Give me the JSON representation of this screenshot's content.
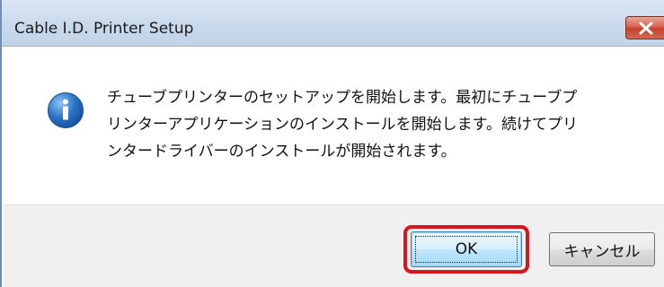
{
  "window": {
    "title": "Cable I.D. Printer Setup",
    "close_icon": "close-icon"
  },
  "dialog": {
    "icon": "info-icon",
    "message_lines": [
      "チューブプリンターのセットアップを開始します。最初にチューブプ",
      "リンターアプリケーションのインストールを開始します。続けてプリ",
      "ンタードライバーのインストールが開始されます。"
    ]
  },
  "buttons": {
    "ok_label": "OK",
    "cancel_label": "キャンセル"
  },
  "colors": {
    "highlight": "#d9141c",
    "titlebar": "#c9d9ec",
    "close_button": "#c4412d",
    "info_icon": "#1f5fb0"
  }
}
